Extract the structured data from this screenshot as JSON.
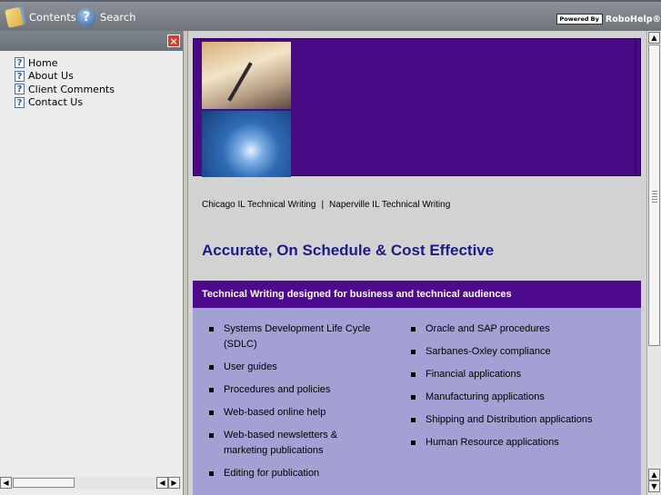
{
  "toolbar": {
    "contents_label": "Contents",
    "search_label": "Search",
    "powered_by": "Powered By",
    "robohelp": "RoboHelp®"
  },
  "nav": {
    "items": [
      {
        "label": "Home"
      },
      {
        "label": "About Us"
      },
      {
        "label": "Client Comments"
      },
      {
        "label": "Contact Us"
      }
    ]
  },
  "content": {
    "links": [
      "Chicago IL Technical Writing",
      "Naperville IL Technical Writing"
    ],
    "link_separator": "|",
    "headline": "Accurate, On Schedule & Cost Effective",
    "section_title": "Technical Writing designed for business and technical audiences",
    "left_list": [
      "Systems Development Life Cycle (SDLC)",
      "User guides",
      "Procedures and policies",
      "Web-based online help",
      "Web-based newsletters & marketing publications",
      "Editing for publication"
    ],
    "right_list": [
      "Oracle and SAP procedures",
      "Sarbanes-Oxley compliance",
      "Financial applications",
      "Manufacturing applications",
      "Shipping and Distribution applications",
      "Human Resource applications"
    ]
  },
  "colors": {
    "banner": "#4a0a86",
    "section_head": "#4e0a8c",
    "section_body": "#a3a0d4",
    "headline": "#1d1a8a"
  }
}
